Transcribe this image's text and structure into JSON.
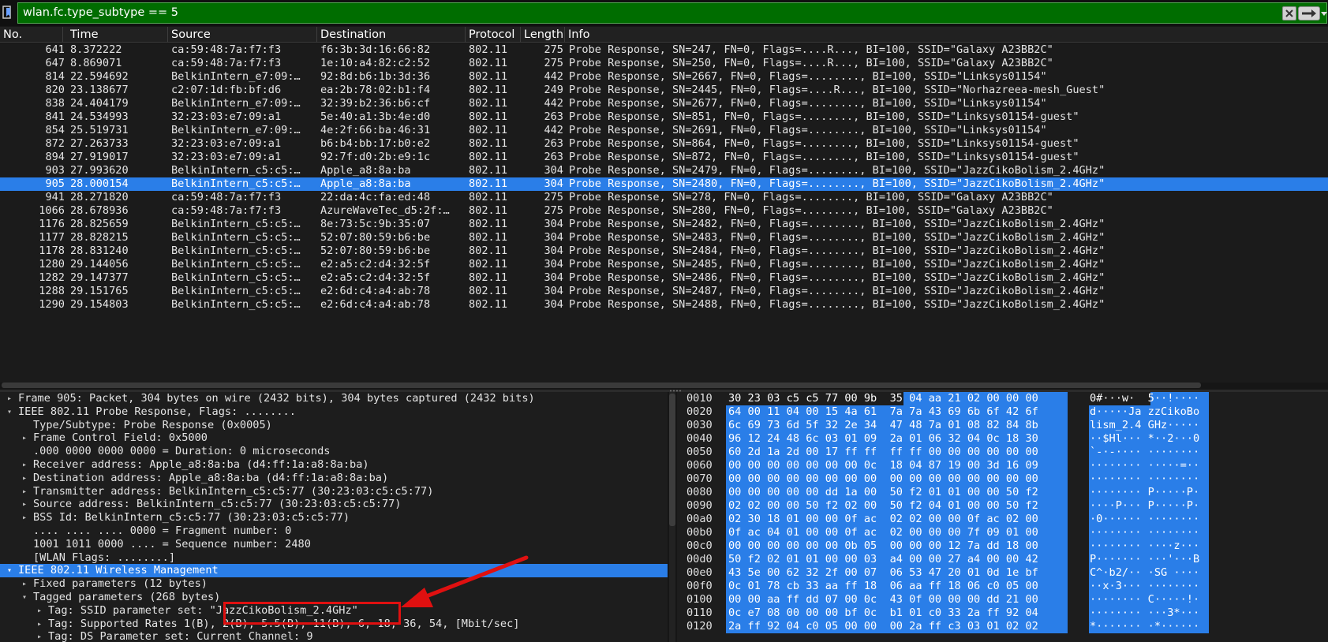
{
  "filter": {
    "value": "wlan.fc.type_subtype == 5",
    "color": "#006d00"
  },
  "columns": [
    "No.",
    "Time",
    "Source",
    "Destination",
    "Protocol",
    "Length",
    "Info"
  ],
  "packets": [
    {
      "no": "641",
      "time": "8.372222",
      "src": "ca:59:48:7a:f7:f3",
      "dst": "f6:3b:3d:16:66:82",
      "proto": "802.11",
      "len": "275",
      "info": "Probe Response, SN=247, FN=0, Flags=....R..., BI=100, SSID=\"Galaxy A23BB2C\""
    },
    {
      "no": "647",
      "time": "8.869071",
      "src": "ca:59:48:7a:f7:f3",
      "dst": "1e:10:a4:82:c2:52",
      "proto": "802.11",
      "len": "275",
      "info": "Probe Response, SN=250, FN=0, Flags=....R..., BI=100, SSID=\"Galaxy A23BB2C\""
    },
    {
      "no": "814",
      "time": "22.594692",
      "src": "BelkinIntern_e7:09:…",
      "dst": "92:8d:b6:1b:3d:36",
      "proto": "802.11",
      "len": "442",
      "info": "Probe Response, SN=2667, FN=0, Flags=........, BI=100, SSID=\"Linksys01154\""
    },
    {
      "no": "820",
      "time": "23.138677",
      "src": "c2:07:1d:fb:bf:d6",
      "dst": "ea:2b:78:02:b1:f4",
      "proto": "802.11",
      "len": "249",
      "info": "Probe Response, SN=2445, FN=0, Flags=....R..., BI=100, SSID=\"Norhazreea-mesh_Guest\""
    },
    {
      "no": "838",
      "time": "24.404179",
      "src": "BelkinIntern_e7:09:…",
      "dst": "32:39:b2:36:b6:cf",
      "proto": "802.11",
      "len": "442",
      "info": "Probe Response, SN=2677, FN=0, Flags=........, BI=100, SSID=\"Linksys01154\""
    },
    {
      "no": "841",
      "time": "24.534993",
      "src": "32:23:03:e7:09:a1",
      "dst": "5e:40:a1:3b:4e:d0",
      "proto": "802.11",
      "len": "263",
      "info": "Probe Response, SN=851, FN=0, Flags=........, BI=100, SSID=\"Linksys01154-guest\""
    },
    {
      "no": "854",
      "time": "25.519731",
      "src": "BelkinIntern_e7:09:…",
      "dst": "4e:2f:66:ba:46:31",
      "proto": "802.11",
      "len": "442",
      "info": "Probe Response, SN=2691, FN=0, Flags=........, BI=100, SSID=\"Linksys01154\""
    },
    {
      "no": "872",
      "time": "27.263733",
      "src": "32:23:03:e7:09:a1",
      "dst": "b6:b4:bb:17:b0:e2",
      "proto": "802.11",
      "len": "263",
      "info": "Probe Response, SN=864, FN=0, Flags=........, BI=100, SSID=\"Linksys01154-guest\""
    },
    {
      "no": "894",
      "time": "27.919017",
      "src": "32:23:03:e7:09:a1",
      "dst": "92:7f:d0:2b:e9:1c",
      "proto": "802.11",
      "len": "263",
      "info": "Probe Response, SN=872, FN=0, Flags=........, BI=100, SSID=\"Linksys01154-guest\""
    },
    {
      "no": "903",
      "time": "27.993620",
      "src": "BelkinIntern_c5:c5:…",
      "dst": "Apple_a8:8a:ba",
      "proto": "802.11",
      "len": "304",
      "info": "Probe Response, SN=2479, FN=0, Flags=........, BI=100, SSID=\"JazzCikoBolism_2.4GHz\""
    },
    {
      "no": "905",
      "time": "28.000154",
      "src": "BelkinIntern_c5:c5:…",
      "dst": "Apple_a8:8a:ba",
      "proto": "802.11",
      "len": "304",
      "info": "Probe Response, SN=2480, FN=0, Flags=........, BI=100, SSID=\"JazzCikoBolism_2.4GHz\"",
      "selected": true
    },
    {
      "no": "941",
      "time": "28.271820",
      "src": "ca:59:48:7a:f7:f3",
      "dst": "22:da:4c:fa:ed:48",
      "proto": "802.11",
      "len": "275",
      "info": "Probe Response, SN=278, FN=0, Flags=........, BI=100, SSID=\"Galaxy A23BB2C\""
    },
    {
      "no": "1066",
      "time": "28.678936",
      "src": "ca:59:48:7a:f7:f3",
      "dst": "AzureWaveTec_d5:2f:…",
      "proto": "802.11",
      "len": "275",
      "info": "Probe Response, SN=280, FN=0, Flags=........, BI=100, SSID=\"Galaxy A23BB2C\""
    },
    {
      "no": "1176",
      "time": "28.825659",
      "src": "BelkinIntern_c5:c5:…",
      "dst": "8e:73:5c:9b:35:07",
      "proto": "802.11",
      "len": "304",
      "info": "Probe Response, SN=2482, FN=0, Flags=........, BI=100, SSID=\"JazzCikoBolism_2.4GHz\""
    },
    {
      "no": "1177",
      "time": "28.828215",
      "src": "BelkinIntern_c5:c5:…",
      "dst": "52:07:80:59:b6:be",
      "proto": "802.11",
      "len": "304",
      "info": "Probe Response, SN=2483, FN=0, Flags=........, BI=100, SSID=\"JazzCikoBolism_2.4GHz\""
    },
    {
      "no": "1178",
      "time": "28.831240",
      "src": "BelkinIntern_c5:c5:…",
      "dst": "52:07:80:59:b6:be",
      "proto": "802.11",
      "len": "304",
      "info": "Probe Response, SN=2484, FN=0, Flags=........, BI=100, SSID=\"JazzCikoBolism_2.4GHz\""
    },
    {
      "no": "1280",
      "time": "29.144056",
      "src": "BelkinIntern_c5:c5:…",
      "dst": "e2:a5:c2:d4:32:5f",
      "proto": "802.11",
      "len": "304",
      "info": "Probe Response, SN=2485, FN=0, Flags=........, BI=100, SSID=\"JazzCikoBolism_2.4GHz\""
    },
    {
      "no": "1282",
      "time": "29.147377",
      "src": "BelkinIntern_c5:c5:…",
      "dst": "e2:a5:c2:d4:32:5f",
      "proto": "802.11",
      "len": "304",
      "info": "Probe Response, SN=2486, FN=0, Flags=........, BI=100, SSID=\"JazzCikoBolism_2.4GHz\""
    },
    {
      "no": "1288",
      "time": "29.151765",
      "src": "BelkinIntern_c5:c5:…",
      "dst": "e2:6d:c4:a4:ab:78",
      "proto": "802.11",
      "len": "304",
      "info": "Probe Response, SN=2487, FN=0, Flags=........, BI=100, SSID=\"JazzCikoBolism_2.4GHz\""
    },
    {
      "no": "1290",
      "time": "29.154803",
      "src": "BelkinIntern_c5:c5:…",
      "dst": "e2:6d:c4:a4:ab:78",
      "proto": "802.11",
      "len": "304",
      "info": "Probe Response, SN=2488, FN=0, Flags=........, BI=100, SSID=\"JazzCikoBolism_2.4GHz\""
    }
  ],
  "details": [
    {
      "indent": 0,
      "arrow": "right",
      "text": "Frame 905: Packet, 304 bytes on wire (2432 bits), 304 bytes captured (2432 bits)"
    },
    {
      "indent": 0,
      "arrow": "down",
      "text": "IEEE 802.11 Probe Response, Flags: ........"
    },
    {
      "indent": 1,
      "arrow": "",
      "text": "Type/Subtype: Probe Response (0x0005)"
    },
    {
      "indent": 1,
      "arrow": "right",
      "text": "Frame Control Field: 0x5000"
    },
    {
      "indent": 1,
      "arrow": "",
      "text": ".000 0000 0000 0000 = Duration: 0 microseconds"
    },
    {
      "indent": 1,
      "arrow": "right",
      "text": "Receiver address: Apple_a8:8a:ba (d4:ff:1a:a8:8a:ba)"
    },
    {
      "indent": 1,
      "arrow": "right",
      "text": "Destination address: Apple_a8:8a:ba (d4:ff:1a:a8:8a:ba)"
    },
    {
      "indent": 1,
      "arrow": "right",
      "text": "Transmitter address: BelkinIntern_c5:c5:77 (30:23:03:c5:c5:77)"
    },
    {
      "indent": 1,
      "arrow": "right",
      "text": "Source address: BelkinIntern_c5:c5:77 (30:23:03:c5:c5:77)"
    },
    {
      "indent": 1,
      "arrow": "right",
      "text": "BSS Id: BelkinIntern_c5:c5:77 (30:23:03:c5:c5:77)"
    },
    {
      "indent": 1,
      "arrow": "",
      "text": ".... .... .... 0000 = Fragment number: 0"
    },
    {
      "indent": 1,
      "arrow": "",
      "text": "1001 1011 0000 .... = Sequence number: 2480"
    },
    {
      "indent": 1,
      "arrow": "",
      "text": "[WLAN Flags: ........]"
    },
    {
      "indent": 0,
      "arrow": "down",
      "text": "IEEE 802.11 Wireless Management",
      "selected": true
    },
    {
      "indent": 1,
      "arrow": "right",
      "text": "Fixed parameters (12 bytes)"
    },
    {
      "indent": 1,
      "arrow": "down",
      "text": "Tagged parameters (268 bytes)"
    },
    {
      "indent": 2,
      "arrow": "right",
      "text": "Tag: SSID parameter set: \"JazzCikoBolism_2.4GHz\""
    },
    {
      "indent": 2,
      "arrow": "right",
      "text": "Tag: Supported Rates 1(B), 2(B), 5.5(B), 11(B), 6, 18, 36, 54, [Mbit/sec]"
    },
    {
      "indent": 2,
      "arrow": "right",
      "text": "Tag: DS Parameter set: Current Channel: 9"
    }
  ],
  "hex": [
    {
      "offset": "0010",
      "bytes": "30 23 03 c5 c5 77 00 9b  35 04 aa 21 02 00 00 00",
      "ascii": "0#···w·  5··!····",
      "hl": "part"
    },
    {
      "offset": "0020",
      "bytes": "64 00 11 04 00 15 4a 61  7a 7a 43 69 6b 6f 42 6f",
      "ascii": "d·····Ja zzCikoBo",
      "hl": "full"
    },
    {
      "offset": "0030",
      "bytes": "6c 69 73 6d 5f 32 2e 34  47 48 7a 01 08 82 84 8b",
      "ascii": "lism_2.4 GHz·····",
      "hl": "full"
    },
    {
      "offset": "0040",
      "bytes": "96 12 24 48 6c 03 01 09  2a 01 06 32 04 0c 18 30",
      "ascii": "··$Hl··· *··2···0",
      "hl": "full"
    },
    {
      "offset": "0050",
      "bytes": "60 2d 1a 2d 00 17 ff ff  ff ff 00 00 00 00 00 00",
      "ascii": "`-·-···· ········",
      "hl": "full"
    },
    {
      "offset": "0060",
      "bytes": "00 00 00 00 00 00 00 0c  18 04 87 19 00 3d 16 09",
      "ascii": "········ ·····=··",
      "hl": "full"
    },
    {
      "offset": "0070",
      "bytes": "00 00 00 00 00 00 00 00  00 00 00 00 00 00 00 00",
      "ascii": "········ ········",
      "hl": "full"
    },
    {
      "offset": "0080",
      "bytes": "00 00 00 00 00 dd 1a 00  50 f2 01 01 00 00 50 f2",
      "ascii": "········ P·····P·",
      "hl": "full"
    },
    {
      "offset": "0090",
      "bytes": "02 02 00 00 50 f2 02 00  50 f2 04 01 00 00 50 f2",
      "ascii": "····P··· P·····P·",
      "hl": "full"
    },
    {
      "offset": "00a0",
      "bytes": "02 30 18 01 00 00 0f ac  02 02 00 00 0f ac 02 00",
      "ascii": "·0······ ········",
      "hl": "full"
    },
    {
      "offset": "00b0",
      "bytes": "0f ac 04 01 00 00 0f ac  02 00 00 00 7f 09 01 00",
      "ascii": "········ ········",
      "hl": "full"
    },
    {
      "offset": "00c0",
      "bytes": "00 00 00 00 00 00 0b 05  00 00 00 12 7a dd 18 00",
      "ascii": "········ ····z···",
      "hl": "full"
    },
    {
      "offset": "00d0",
      "bytes": "50 f2 02 01 01 00 00 03  a4 00 00 27 a4 00 00 42",
      "ascii": "P······· ···'···B",
      "hl": "full"
    },
    {
      "offset": "00e0",
      "bytes": "43 5e 00 62 32 2f 00 07  06 53 47 20 01 0d 1e bf",
      "ascii": "C^·b2/·· ·SG ····",
      "hl": "full"
    },
    {
      "offset": "00f0",
      "bytes": "0c 01 78 cb 33 aa ff 18  06 aa ff 18 06 c0 05 00",
      "ascii": "··x·3··· ········",
      "hl": "full"
    },
    {
      "offset": "0100",
      "bytes": "00 00 aa ff dd 07 00 0c  43 0f 00 00 00 dd 21 00",
      "ascii": "········ C·····!·",
      "hl": "full"
    },
    {
      "offset": "0110",
      "bytes": "0c e7 08 00 00 00 bf 0c  b1 01 c0 33 2a ff 92 04",
      "ascii": "········ ···3*···",
      "hl": "full"
    },
    {
      "offset": "0120",
      "bytes": "2a ff 92 04 c0 05 00 00  00 2a ff c3 03 01 02 02",
      "ascii": "*······· ·*······",
      "hl": "full"
    }
  ],
  "colors": {
    "selection": "#2a7ee8",
    "annotation": "#e01010"
  }
}
